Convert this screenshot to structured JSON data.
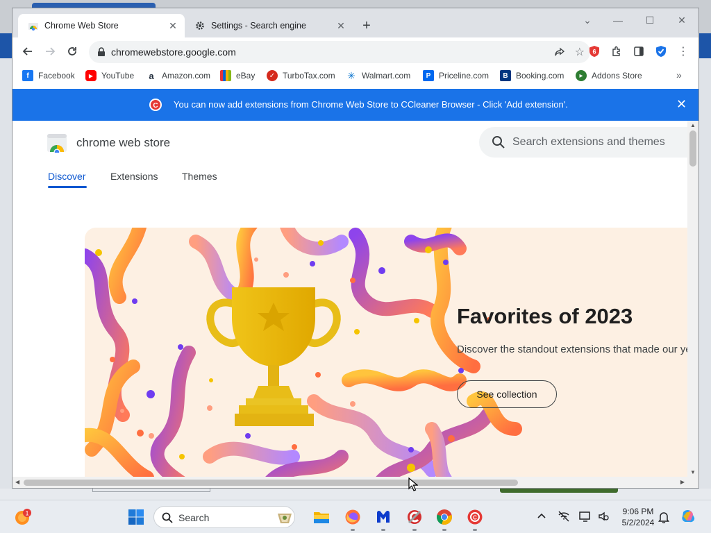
{
  "browser": {
    "tabs": [
      {
        "title": "Chrome Web Store",
        "icon": "chrome-web-store-icon",
        "active": true
      },
      {
        "title": "Settings - Search engine",
        "icon": "gear-icon",
        "active": false
      }
    ],
    "new_tab_label": "+",
    "url": "chromewebstore.google.com",
    "bookmarks": [
      {
        "label": "Facebook",
        "icon": "facebook-icon",
        "color": "#1877f2"
      },
      {
        "label": "YouTube",
        "icon": "youtube-icon",
        "color": "#ff0000"
      },
      {
        "label": "Amazon.com",
        "icon": "amazon-icon",
        "color": "#232f3e"
      },
      {
        "label": "eBay",
        "icon": "ebay-icon",
        "color": "#e53238"
      },
      {
        "label": "TurboTax.com",
        "icon": "turbotax-icon",
        "color": "#d52b1e"
      },
      {
        "label": "Walmart.com",
        "icon": "walmart-icon",
        "color": "#0071ce"
      },
      {
        "label": "Priceline.com",
        "icon": "priceline-icon",
        "color": "#0068ef"
      },
      {
        "label": "Booking.com",
        "icon": "booking-icon",
        "color": "#003580"
      },
      {
        "label": "Addons Store",
        "icon": "addons-store-icon",
        "color": "#2e7d32"
      }
    ],
    "bookmarks_more": "»"
  },
  "infobar": {
    "message": "You can now add extensions from Chrome Web Store to CCleaner Browser - Click 'Add extension'.",
    "close": "✕",
    "color": "#1a73e8"
  },
  "store": {
    "name": "chrome web store",
    "search_placeholder": "Search extensions and themes",
    "nav": [
      {
        "label": "Discover",
        "active": true
      },
      {
        "label": "Extensions",
        "active": false
      },
      {
        "label": "Themes",
        "active": false
      }
    ],
    "banner": {
      "title": "Favorites of 2023",
      "description": "Discover the standout extensions that made our year",
      "button": "See collection"
    }
  },
  "taskbar": {
    "search_label": "Search",
    "notification_count": "1",
    "time": "9:06 PM",
    "date": "5/2/2024"
  }
}
